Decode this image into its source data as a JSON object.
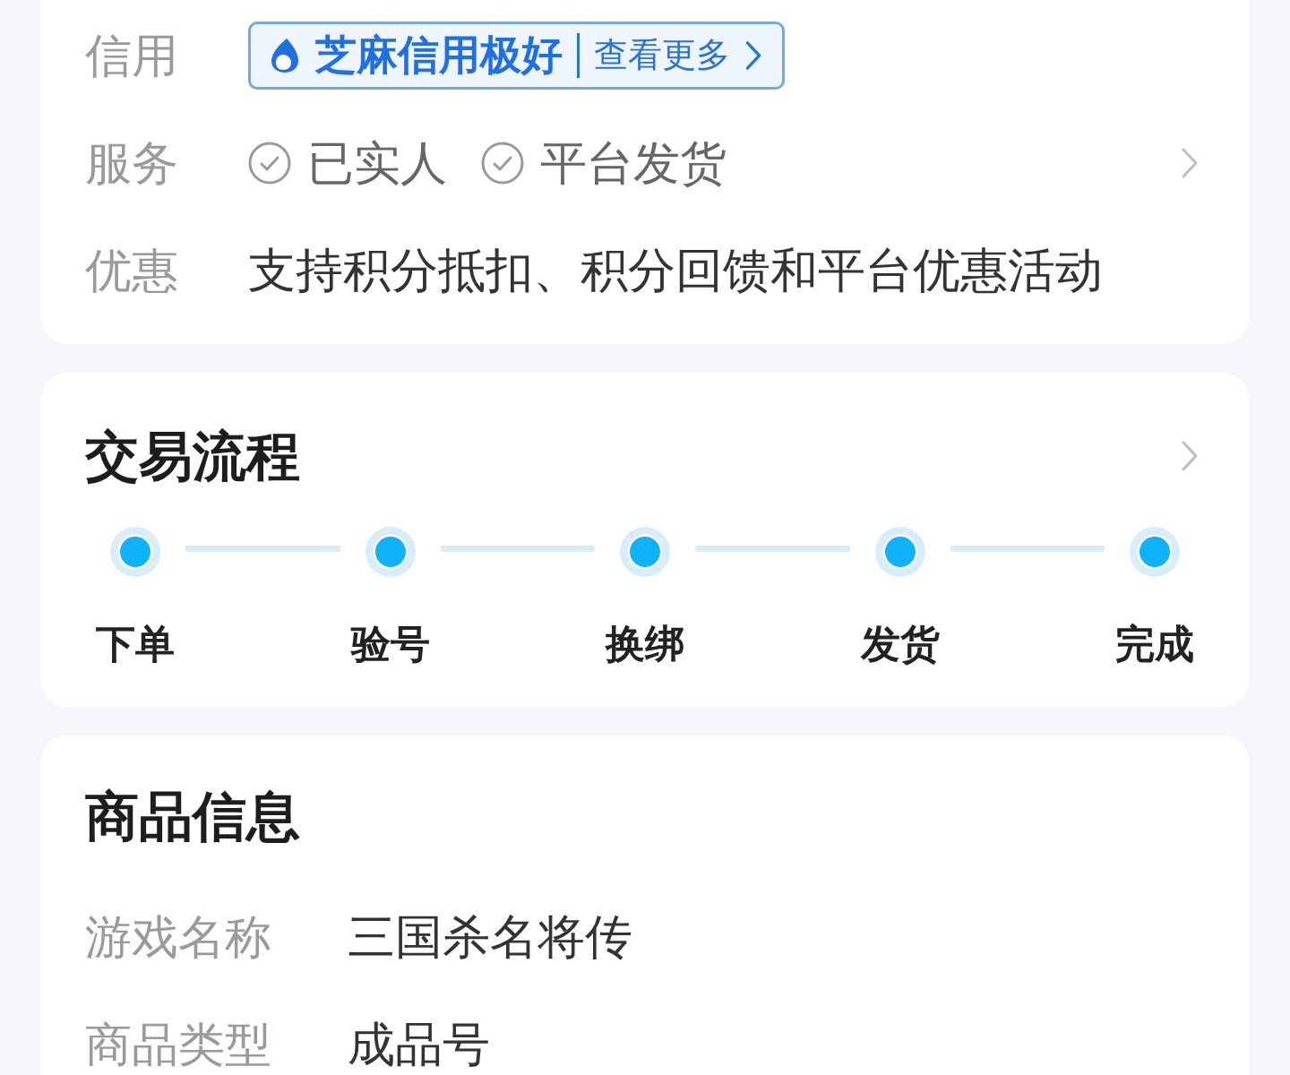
{
  "guarantee_card": {
    "rows": [
      {
        "kind": "credit",
        "label": "信用",
        "badge": "芝麻信用极好",
        "link": "查看更多"
      },
      {
        "kind": "services",
        "label": "服务",
        "tags": [
          "已实人",
          "平台发货"
        ]
      },
      {
        "kind": "text",
        "label": "优惠",
        "value": "支持积分抵扣、积分回馈和平台优惠活动"
      }
    ]
  },
  "trade_process": {
    "title": "交易流程",
    "steps": [
      "下单",
      "验号",
      "换绑",
      "发货",
      "完成"
    ]
  },
  "product_info": {
    "title": "商品信息",
    "fields": [
      {
        "label": "游戏名称",
        "value": "三国杀名将传"
      },
      {
        "label": "商品类型",
        "value": "成品号"
      }
    ]
  }
}
